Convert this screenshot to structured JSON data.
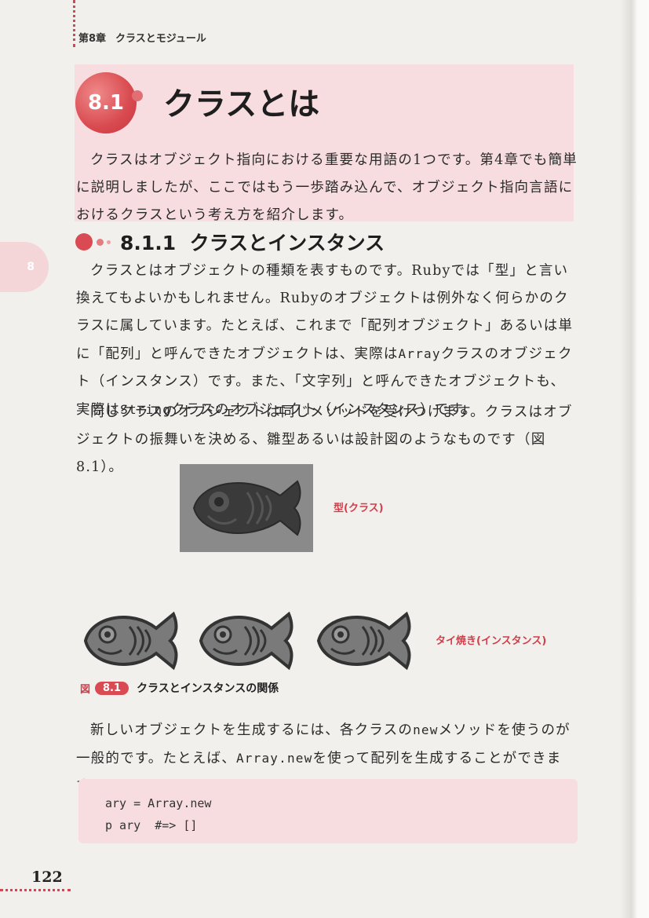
{
  "header": {
    "chapter_label": "第8章",
    "chapter_title": "クラスとモジュール"
  },
  "section": {
    "number": "8.1",
    "title": "クラスとは"
  },
  "intro": "クラスはオブジェクト指向における重要な用語の1つです。第4章でも簡単に説明しましたが、ここではもう一歩踏み込んで、オブジェクト指向言語におけるクラスという考え方を紹介します。",
  "side_tab": "8",
  "subsection": {
    "number": "8.1.1",
    "title": "クラスとインスタンス"
  },
  "para_class": {
    "t1": "クラスとはオブジェクトの種類を表すものです。Rubyでは「型」と言い換えてもよいかもしれません。Rubyのオブジェクトは例外なく何らかのクラスに属しています。たとえば、これまで「配列オブジェクト」あるいは単に「配列」と呼んできたオブジェクトは、実際は",
    "c1": "Array",
    "t2": "クラスのオブジェクト（インスタンス）です。また、「文字列」と呼んできたオブジェクトも、実際は",
    "c2": "String",
    "t3": "クラスのオブジェクト（インスタンス）です。"
  },
  "para_same": "同じクラスのオブジェクトは同じメソッドを受けつけます。クラスはオブジェクトの振舞いを決める、雛型あるいは設計図のようなものです（図8.1）。",
  "figure": {
    "mold_label": "型(クラス)",
    "instance_label": "タイ焼き(インスタンス)",
    "caption_prefix": "図",
    "caption_number": "8.1",
    "caption_text": "クラスとインスタンスの関係"
  },
  "para_new": {
    "t1": "新しいオブジェクトを生成するには、各クラスの",
    "c1": "new",
    "t2": "メソッドを使うのが一般的です。たとえば、",
    "c2": "Array.new",
    "t3": "を使って配列を生成することができます。"
  },
  "code": {
    "line1": "ary = Array.new",
    "line2": "p ary  #=> []"
  },
  "page_number": "122",
  "colors": {
    "accent": "#d94a52",
    "highlight_bg": "#f7dde0",
    "fish_dark": "#3a3a3a",
    "fish_light": "#7a7a7a"
  }
}
